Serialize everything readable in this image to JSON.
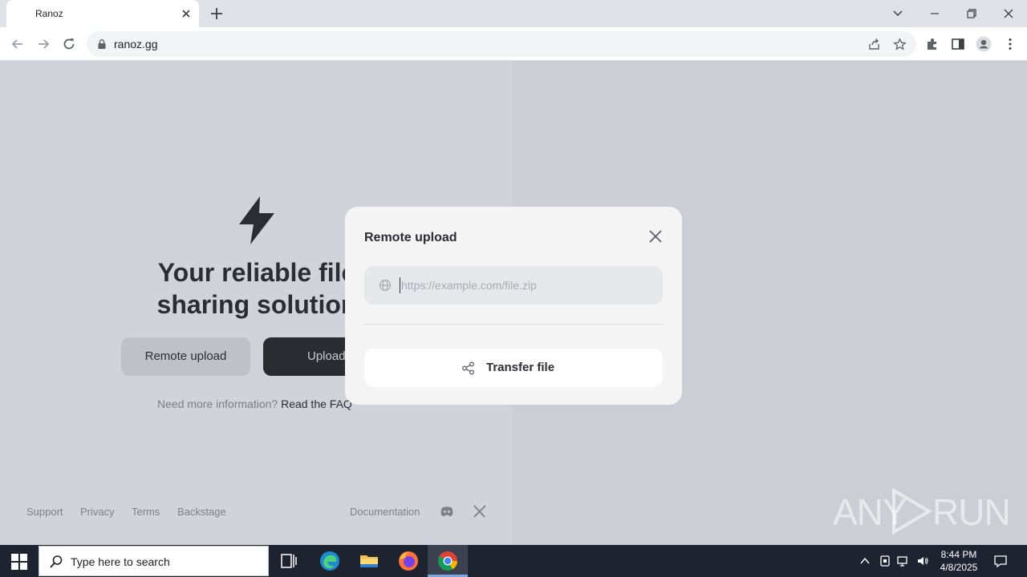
{
  "browser": {
    "tab_title": "Ranoz",
    "url": "ranoz.gg"
  },
  "page": {
    "hero_line1": "Your reliable file",
    "hero_line2": "sharing solution",
    "remote_upload_label": "Remote upload",
    "upload_label": "Upload",
    "faq_prefix": "Need more information?",
    "faq_link": "Read the FAQ",
    "footer": {
      "support": "Support",
      "privacy": "Privacy",
      "terms": "Terms",
      "backstage": "Backstage",
      "documentation": "Documentation"
    }
  },
  "modal": {
    "title": "Remote upload",
    "url_placeholder": "https://example.com/file.zip",
    "url_value": "",
    "transfer_label": "Transfer file"
  },
  "watermark": {
    "left": "ANY",
    "right": "RUN"
  },
  "taskbar": {
    "search_placeholder": "Type here to search",
    "time": "8:44 PM",
    "date": "4/8/2025"
  },
  "colors": {
    "accent_dark": "#2a2c31",
    "modal_bg": "#f4f4f5",
    "taskbar_bg": "#1e2330"
  }
}
